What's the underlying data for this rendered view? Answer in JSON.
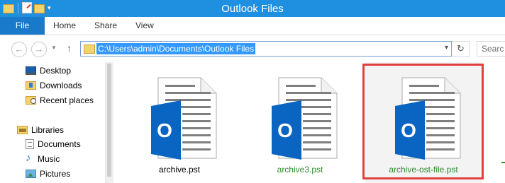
{
  "window": {
    "title": "Outlook Files",
    "accent": "#1f8fe0"
  },
  "ribbon": {
    "tabs": [
      {
        "label": "File",
        "active": true
      },
      {
        "label": "Home"
      },
      {
        "label": "Share"
      },
      {
        "label": "View"
      }
    ]
  },
  "addressbar": {
    "path": "C:\\Users\\admin\\Documents\\Outlook Files",
    "search_placeholder": "Searc"
  },
  "sidebar": {
    "items": [
      {
        "label": "Desktop",
        "icon": "desktop-icon"
      },
      {
        "label": "Downloads",
        "icon": "downloads-folder-icon"
      },
      {
        "label": "Recent places",
        "icon": "recent-places-icon"
      },
      {
        "label": "Libraries",
        "icon": "libraries-icon"
      },
      {
        "label": "Documents",
        "icon": "documents-icon"
      },
      {
        "label": "Music",
        "icon": "music-icon"
      },
      {
        "label": "Pictures",
        "icon": "pictures-icon"
      }
    ]
  },
  "files": [
    {
      "name": "archive.pst",
      "color": "#000000",
      "icon": "outlook-data-file-icon"
    },
    {
      "name": "archive3.pst",
      "color": "#2e8b2e",
      "icon": "outlook-data-file-icon"
    },
    {
      "name": "archive-ost-file.pst",
      "color": "#2e8b2e",
      "icon": "outlook-data-file-icon",
      "selected": true
    }
  ],
  "colors": {
    "file_blue": "#0a64c2",
    "highlight_red": "#e0413f",
    "compressed_green": "#2e8b2e"
  }
}
